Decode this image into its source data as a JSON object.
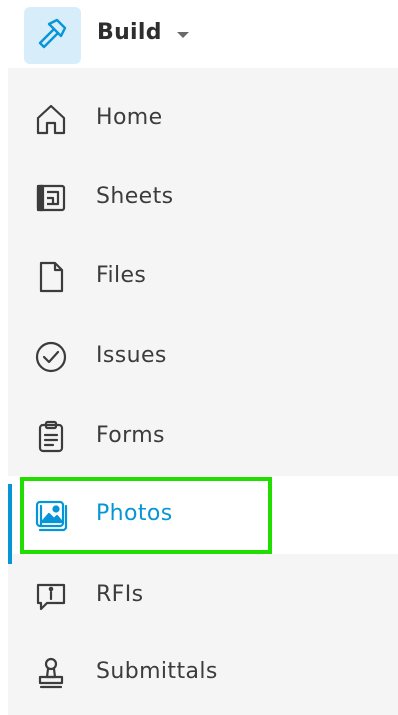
{
  "app": {
    "title": "Build",
    "icon": "hammer-icon"
  },
  "sidebar": {
    "items": [
      {
        "label": "Home",
        "icon": "home-icon",
        "active": false
      },
      {
        "label": "Sheets",
        "icon": "sheets-icon",
        "active": false
      },
      {
        "label": "Files",
        "icon": "file-icon",
        "active": false
      },
      {
        "label": "Issues",
        "icon": "check-circle-icon",
        "active": false
      },
      {
        "label": "Forms",
        "icon": "clipboard-icon",
        "active": false
      },
      {
        "label": "Photos",
        "icon": "image-icon",
        "active": true
      },
      {
        "label": "RFIs",
        "icon": "speech-bubble-info-icon",
        "active": false
      },
      {
        "label": "Submittals",
        "icon": "stamp-icon",
        "active": false
      }
    ]
  },
  "colors": {
    "accent": "#0696d7",
    "highlight": "#22dd00",
    "sidebar_bg": "#f5f5f5",
    "text": "#3c3c3c"
  }
}
